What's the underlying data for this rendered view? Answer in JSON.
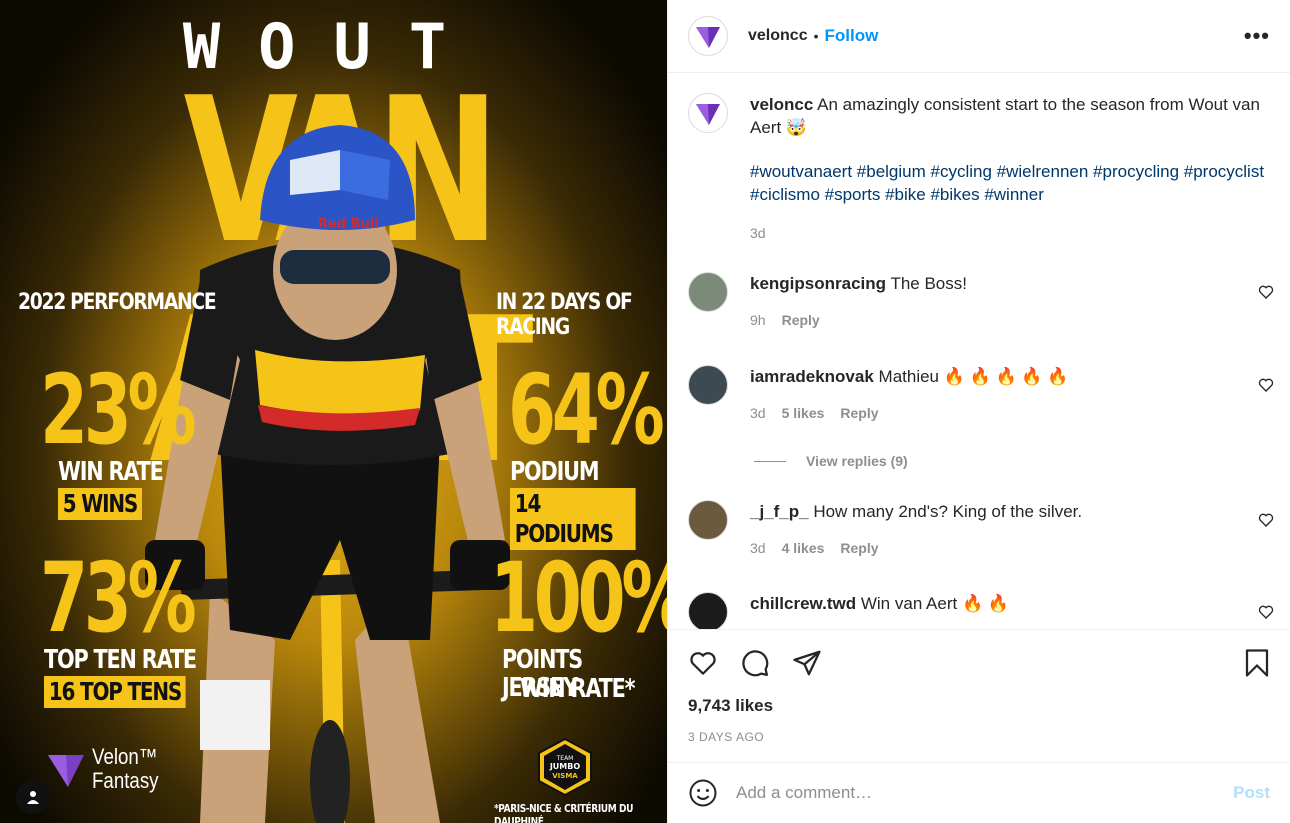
{
  "post_image": {
    "top_word": "WOUT",
    "name": "VAN AERT",
    "left_subtitle": "2022 PERFORMANCE",
    "right_subtitle": "IN 22 DAYS OF RACING",
    "stats": [
      {
        "value": "23%",
        "label": "WIN RATE",
        "pill": "5 WINS"
      },
      {
        "value": "64%",
        "label": "PODIUM RATE",
        "pill": "14 PODIUMS"
      },
      {
        "value": "73%",
        "label": "TOP TEN RATE",
        "pill": "16 TOP TENS"
      },
      {
        "value": "100%",
        "label_line1": "POINTS JERSEY",
        "label_line2": "WIN RATE*"
      }
    ],
    "brand_line1": "Velon™",
    "brand_line2": "Fantasy",
    "team_badge": {
      "l1": "TEAM",
      "l2": "JUMBO",
      "l3": "VISMA"
    },
    "footnote": "*PARIS-NICE & CRITÉRIUM DU DAUPHINÉ",
    "accent": "#f6c419"
  },
  "header": {
    "username": "veloncc",
    "separator": "•",
    "follow_label": "Follow",
    "more_icon": "•••"
  },
  "caption": {
    "username": "veloncc",
    "text": "An amazingly consistent start to the season from Wout van Aert 🤯",
    "hashtags": "#woutvanaert #belgium #cycling #wielrennen #procycling #procyclist #ciclismo #sports #bike #bikes #winner",
    "time": "3d"
  },
  "comments": [
    {
      "username": "kengipsonracing",
      "text": "The Boss!",
      "time": "9h",
      "likes": "",
      "reply": "Reply"
    },
    {
      "username": "iamradeknovak",
      "text": "Mathieu 🔥 🔥 🔥 🔥 🔥",
      "time": "3d",
      "likes": "5 likes",
      "reply": "Reply",
      "view_replies": "View replies (9)"
    },
    {
      "username": "_j_f_p_",
      "text": "How many 2nd's? King of the silver.",
      "time": "3d",
      "likes": "4 likes",
      "reply": "Reply"
    },
    {
      "username": "chillcrew.twd",
      "text": "Win van Aert 🔥 🔥"
    }
  ],
  "likes_label": "9,743 likes",
  "posted_ago": "3 DAYS AGO",
  "add_comment": {
    "placeholder": "Add a comment…",
    "post_label": "Post"
  }
}
